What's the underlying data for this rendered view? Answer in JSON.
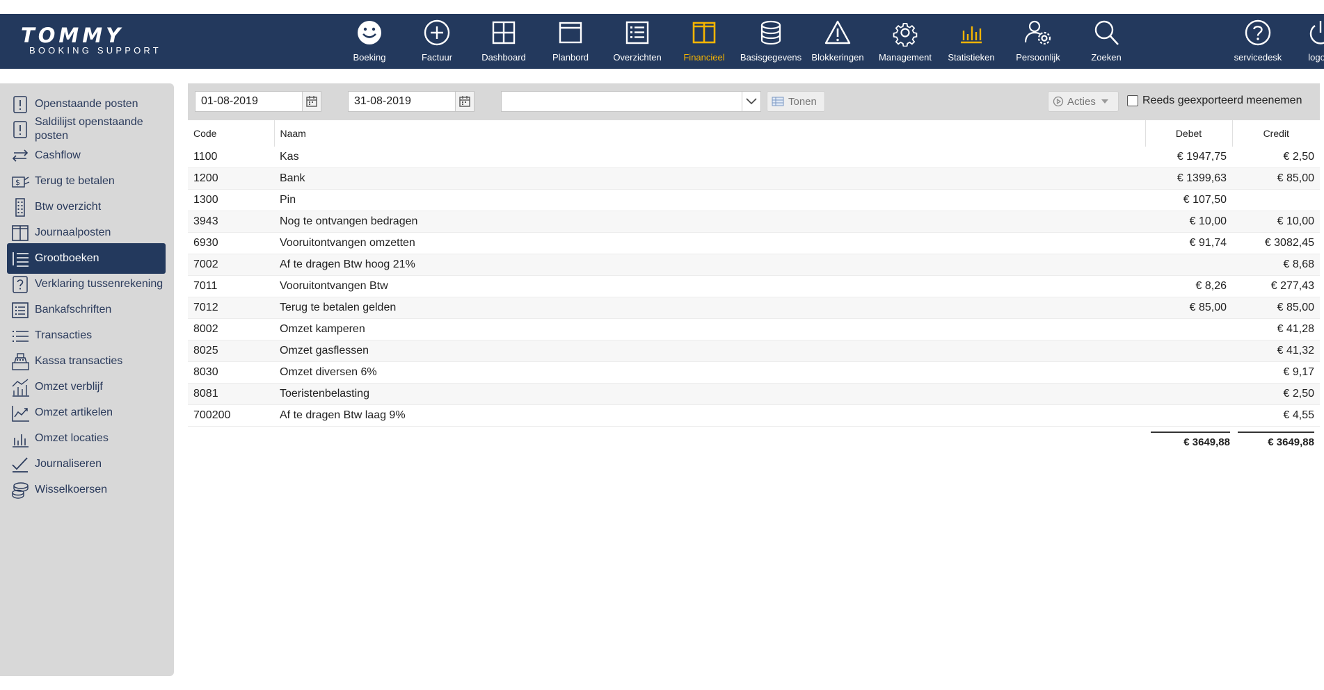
{
  "brand": {
    "name": "TOMMY",
    "tagline": "BOOKING SUPPORT"
  },
  "nav": [
    {
      "label": "Boeking",
      "icon": "smiley-icon"
    },
    {
      "label": "Factuur",
      "icon": "plus-circle-icon"
    },
    {
      "label": "Dashboard",
      "icon": "grid-icon"
    },
    {
      "label": "Planbord",
      "icon": "window-icon"
    },
    {
      "label": "Overzichten",
      "icon": "list-icon"
    },
    {
      "label": "Financieel",
      "icon": "columns-icon"
    },
    {
      "label": "Basisgegevens",
      "icon": "database-icon"
    },
    {
      "label": "Blokkeringen",
      "icon": "warning-icon"
    },
    {
      "label": "Management",
      "icon": "gear-icon"
    },
    {
      "label": "Statistieken",
      "icon": "bar-chart-icon"
    },
    {
      "label": "Persoonlijk",
      "icon": "user-gear-icon"
    },
    {
      "label": "Zoeken",
      "icon": "search-icon"
    },
    {
      "label": "servicedesk",
      "icon": "question-circle-icon"
    },
    {
      "label": "logout",
      "icon": "power-icon"
    }
  ],
  "active_nav": "Financieel",
  "colors": {
    "nav_bg": "#23395d",
    "active_accent": "#f5b400",
    "sidebar_bg": "#d8d8d8"
  },
  "sidebar": [
    {
      "label": "Openstaande posten",
      "icon": "exclamation-doc-icon"
    },
    {
      "label": "Saldilijst openstaande posten",
      "icon": "exclamation-doc-icon"
    },
    {
      "label": "Cashflow",
      "icon": "transfer-arrows-icon"
    },
    {
      "label": "Terug te betalen",
      "icon": "money-hand-icon"
    },
    {
      "label": "Btw overzicht",
      "icon": "building-icon"
    },
    {
      "label": "Journaalposten",
      "icon": "columns-icon"
    },
    {
      "label": "Grootboeken",
      "icon": "numbered-list-icon"
    },
    {
      "label": "Verklaring tussenrekening",
      "icon": "question-box-icon"
    },
    {
      "label": "Bankafschriften",
      "icon": "list-box-icon"
    },
    {
      "label": "Transacties",
      "icon": "list-icon"
    },
    {
      "label": "Kassa transacties",
      "icon": "cash-register-icon"
    },
    {
      "label": "Omzet verblijf",
      "icon": "chart-people-icon"
    },
    {
      "label": "Omzet artikelen",
      "icon": "trend-chart-icon"
    },
    {
      "label": "Omzet locaties",
      "icon": "bar-chart-icon"
    },
    {
      "label": "Journaliseren",
      "icon": "checkmarks-icon"
    },
    {
      "label": "Wisselkoersen",
      "icon": "coins-icon"
    }
  ],
  "active_sidebar": "Grootboeken",
  "filters": {
    "date_from": "01-08-2019",
    "date_to": "31-08-2019",
    "select_value": "",
    "show_button": "Tonen",
    "actions_button": "Acties",
    "include_exported_label": "Reeds geexporteerd meenemen",
    "include_exported_checked": false
  },
  "table": {
    "headers": {
      "code": "Code",
      "name": "Naam",
      "debit": "Debet",
      "credit": "Credit"
    },
    "rows": [
      {
        "code": "1100",
        "name": "Kas",
        "debit": "€ 1947,75",
        "credit": "€ 2,50"
      },
      {
        "code": "1200",
        "name": "Bank",
        "debit": "€ 1399,63",
        "credit": "€ 85,00"
      },
      {
        "code": "1300",
        "name": "Pin",
        "debit": "€ 107,50",
        "credit": ""
      },
      {
        "code": "3943",
        "name": "Nog te ontvangen bedragen",
        "debit": "€ 10,00",
        "credit": "€ 10,00"
      },
      {
        "code": "6930",
        "name": "Vooruitontvangen omzetten",
        "debit": "€ 91,74",
        "credit": "€ 3082,45"
      },
      {
        "code": "7002",
        "name": "Af te dragen Btw hoog 21%",
        "debit": "",
        "credit": "€ 8,68"
      },
      {
        "code": "7011",
        "name": "Vooruitontvangen Btw",
        "debit": "€ 8,26",
        "credit": "€ 277,43"
      },
      {
        "code": "7012",
        "name": "Terug te betalen gelden",
        "debit": "€ 85,00",
        "credit": "€ 85,00"
      },
      {
        "code": "8002",
        "name": "Omzet kamperen",
        "debit": "",
        "credit": "€ 41,28"
      },
      {
        "code": "8025",
        "name": "Omzet gasflessen",
        "debit": "",
        "credit": "€ 41,32"
      },
      {
        "code": "8030",
        "name": "Omzet diversen 6%",
        "debit": "",
        "credit": "€ 9,17"
      },
      {
        "code": "8081",
        "name": "Toeristenbelasting",
        "debit": "",
        "credit": "€ 2,50"
      },
      {
        "code": "700200",
        "name": "Af te dragen Btw laag 9%",
        "debit": "",
        "credit": "€ 4,55"
      }
    ],
    "totals": {
      "debit": "€ 3649,88",
      "credit": "€ 3649,88"
    }
  }
}
